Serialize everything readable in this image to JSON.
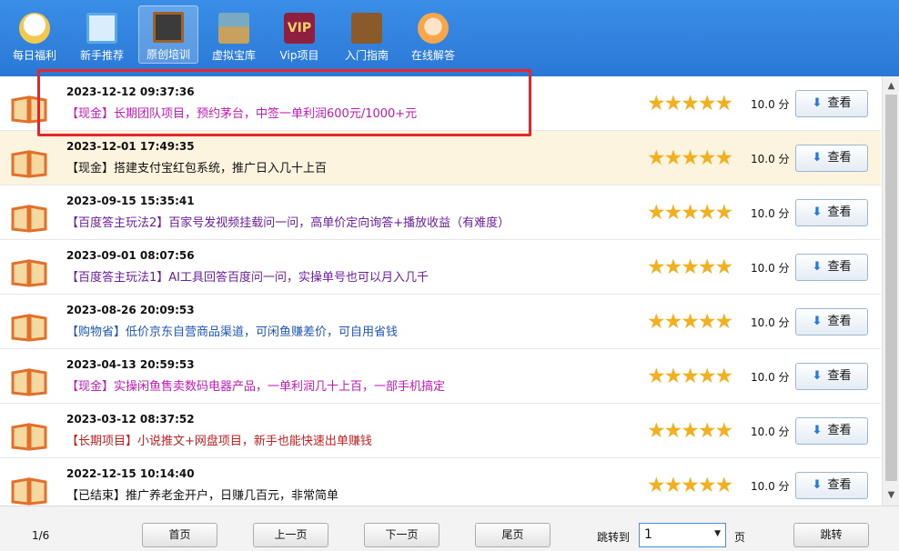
{
  "toolbar": {
    "items": [
      {
        "label": "每日福利",
        "icon": "lucky-cat-icon"
      },
      {
        "label": "新手推荐",
        "icon": "monitor-icon"
      },
      {
        "label": "原创培训",
        "icon": "blackboard-icon",
        "active": true
      },
      {
        "label": "虚拟宝库",
        "icon": "treasure-box-icon"
      },
      {
        "label": "Vip项目",
        "icon": "vip-icon",
        "icon_text": "VIP"
      },
      {
        "label": "入门指南",
        "icon": "guide-book-icon"
      },
      {
        "label": "在线解答",
        "icon": "support-person-icon"
      }
    ]
  },
  "list": {
    "rating_stars": "★★★★★",
    "view_label": "查看",
    "view_arrow": "⬇",
    "rows": [
      {
        "date": "2023-12-12 09:37:36",
        "title": "【现金】长期团队项目，预约茅台，中签一单利润600元/1000+元",
        "title_color": "#c219b7",
        "score": "10.0 分"
      },
      {
        "date": "2023-12-01 17:49:35",
        "title": "【现金】搭建支付宝红包系统，推广日入几十上百",
        "title_color": "#111111",
        "score": "10.0 分"
      },
      {
        "date": "2023-09-15 15:35:41",
        "title": "【百度答主玩法2】百家号发视频挂载问一问，高单价定向询答+播放收益（有难度）",
        "title_color": "#6b1f9e",
        "score": "10.0 分"
      },
      {
        "date": "2023-09-01 08:07:56",
        "title": "【百度答主玩法1】AI工具回答百度问一问，实操单号也可以月入几千",
        "title_color": "#6b1f9e",
        "score": "10.0 分"
      },
      {
        "date": "2023-08-26 20:09:53",
        "title": "【购物省】低价京东自营商品渠道，可闲鱼赚差价，可自用省钱",
        "title_color": "#1f56b8",
        "score": "10.0 分"
      },
      {
        "date": "2023-04-13 20:59:53",
        "title": "【现金】实操闲鱼售卖数码电器产品，一单利润几十上百，一部手机搞定",
        "title_color": "#c219b7",
        "score": "10.0 分"
      },
      {
        "date": "2023-03-12 08:37:52",
        "title": "【长期项目】小说推文+网盘项目，新手也能快速出单赚钱",
        "title_color": "#c22020",
        "score": "10.0 分"
      },
      {
        "date": "2022-12-15 10:14:40",
        "title": "【已结束】推广养老金开户，日赚几百元，非常简单",
        "title_color": "#111111",
        "score": "10.0 分"
      }
    ]
  },
  "footer": {
    "page_info": "1/6",
    "first_label": "首页",
    "prev_label": "上一页",
    "next_label": "下一页",
    "last_label": "尾页",
    "jump_label": "跳转到",
    "jump_value": "1",
    "page_suffix": "页",
    "go_label": "跳转"
  },
  "colors": {
    "toolbar_bg": "#2a78d6",
    "highlight_row": "#fcf4de",
    "star": "#f2b01e",
    "annotation_box": "#e8252b"
  }
}
